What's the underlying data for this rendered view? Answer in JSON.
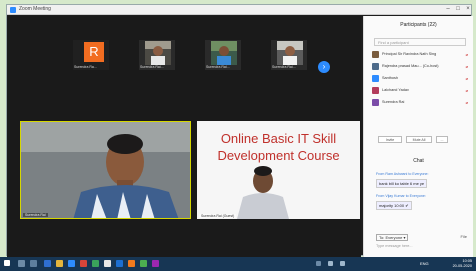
{
  "window": {
    "title": "Zoom Meeting"
  },
  "strip": {
    "tiles": [
      {
        "letter": "R",
        "name": "Surendra Ra..."
      },
      {
        "name": "Surendra Rai..."
      },
      {
        "name": "Surendra Rai..."
      },
      {
        "name": "Surendra Rai..."
      }
    ],
    "next_glyph": "›"
  },
  "speaker": {
    "name": "Surendra Rai"
  },
  "share": {
    "line1": "Online Basic IT Skill",
    "line2": "Development Course",
    "name": "Surendra Rai (Guest)"
  },
  "panel": {
    "title": "Participants (22)",
    "search_placeholder": "Find a participant",
    "participants": [
      {
        "name": "Principal Sir Ravindra Nath Sing"
      },
      {
        "name": "Rajendra prasad Mau... (Co-host)"
      },
      {
        "name": "Santhosh"
      },
      {
        "name": "Lalchand Yadav"
      },
      {
        "name": "Surendra Rai"
      }
    ],
    "buttons": [
      "Invite",
      "Mute All",
      "..."
    ],
    "chat_title": "Chat",
    "messages": [
      {
        "meta": "From Ram Ashwani to Everyone:",
        "text": "bank bill ko table 6 me ye"
      },
      {
        "meta": "From Vijay Kumar to Everyone:",
        "text": "majority 10:00 ✔"
      }
    ],
    "to_label": "To: Everyone ▾",
    "file_label": "File",
    "input_placeholder": "Type message here..."
  },
  "taskbar": {
    "time": "10:05",
    "date": "20-05-2020",
    "tray": "ENG"
  },
  "colors": {
    "accent": "#2d8cff",
    "speaker_border": "#d6d700",
    "slide_title": "#c0312c",
    "avatar_r": "#f26d21",
    "taskbar": "#173654"
  }
}
